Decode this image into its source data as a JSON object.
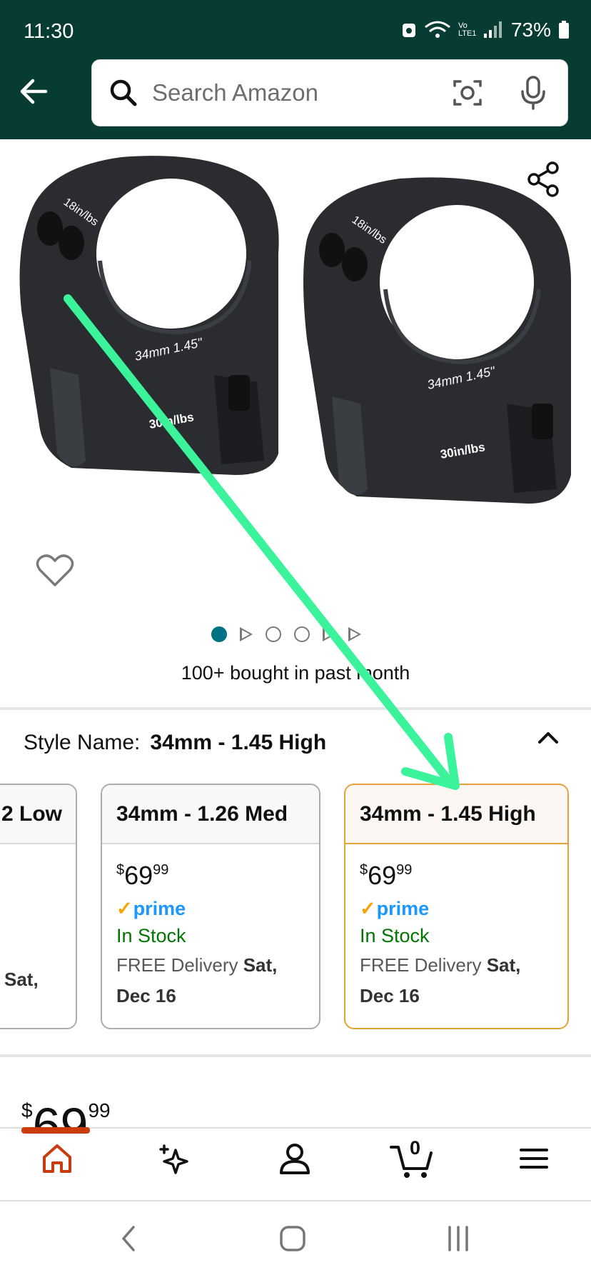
{
  "status_bar": {
    "time": "11:30",
    "battery": "73%",
    "network": "Vo LTE1"
  },
  "header": {
    "search_placeholder": "Search Amazon",
    "back_icon": "back-arrow-icon",
    "camera_icon": "camera-lens-icon",
    "mic_icon": "microphone-icon"
  },
  "gallery": {
    "bought_text": "100+ bought in past month",
    "image_labels": {
      "left_top": "18in/lbs",
      "left_ring": "34mm 1.45\"",
      "left_base": "30in/lbs",
      "right_top": "18in/lbs",
      "right_ring": "34mm 1.45\"",
      "right_base": "30in/lbs"
    }
  },
  "style": {
    "label": "Style Name:",
    "value": "34mm - 1.45 High",
    "cards": [
      {
        "title": "2 Low",
        "delivery_prefix": "",
        "delivery_day": "Sat,",
        "delivery_date": ""
      },
      {
        "title": "34mm - 1.26 Med",
        "price_symbol": "$",
        "price_whole": "69",
        "price_cents": "99",
        "prime": "prime",
        "stock": "In Stock",
        "delivery_prefix": "FREE Delivery",
        "delivery_day": "Sat,",
        "delivery_date": "Dec 16"
      },
      {
        "title": "34mm - 1.45 High",
        "price_symbol": "$",
        "price_whole": "69",
        "price_cents": "99",
        "prime": "prime",
        "stock": "In Stock",
        "delivery_prefix": "FREE Delivery",
        "delivery_day": "Sat,",
        "delivery_date": "Dec 16"
      }
    ]
  },
  "price": {
    "symbol": "$",
    "whole": "69",
    "cents": "99"
  },
  "bottom_nav": {
    "cart_count": "0"
  },
  "colors": {
    "header_bg": "#073c33",
    "accent_teal": "#007185",
    "prime_blue": "#1a98ff",
    "in_stock_green": "#007600",
    "selected_border": "#e6a238",
    "home_active": "#cc3b0e",
    "annotation_arrow": "#3af39a"
  }
}
